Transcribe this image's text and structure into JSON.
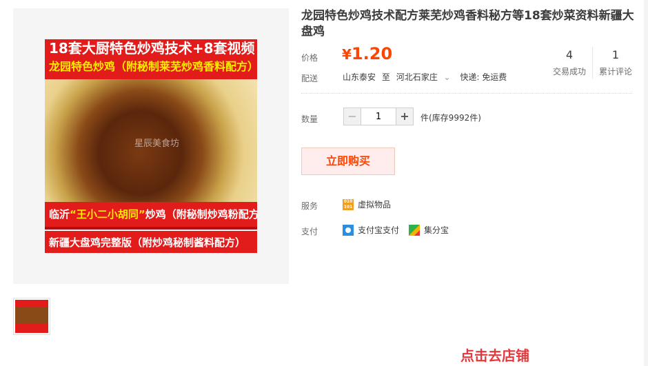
{
  "product": {
    "title": "龙园特色炒鸡技术配方莱芜炒鸡香料秘方等18套炒菜资料新疆大盘鸡",
    "price_label": "价格",
    "currency": "¥",
    "price": "1.20",
    "stats": [
      {
        "value": "4",
        "label": "交易成功"
      },
      {
        "value": "1",
        "label": "累计评论"
      }
    ]
  },
  "image": {
    "line1": "18套大厨特色炒鸡技术+8套视频",
    "line2": "龙园特色炒鸡（附秘制莱芜炒鸡香料配方）",
    "watermark": "星辰美食坊",
    "line3_prefix": "临沂",
    "line3_highlight": "“王小二小胡同”",
    "line3_suffix": "炒鸡（附秘制炒鸡粉配方）",
    "line4": "新疆大盘鸡完整版（附炒鸡秘制酱料配方）"
  },
  "shipping": {
    "label": "配送",
    "from": "山东泰安",
    "to_word": "至",
    "to": "河北石家庄",
    "express": "快递: 免运费"
  },
  "quantity": {
    "label": "数量",
    "value": "1",
    "stock": "件(库存9992件)",
    "minus": "−",
    "plus": "+"
  },
  "buy_button": "立即购买",
  "service": {
    "label": "服务",
    "item": "虚拟物品",
    "icon": "virtual-goods-icon"
  },
  "payment": {
    "label": "支付",
    "methods": [
      {
        "name": "支付宝支付",
        "icon": "alipay-icon",
        "color": "#2a8fe0"
      },
      {
        "name": "集分宝",
        "icon": "jifenbao-icon",
        "color": "#2bb24c"
      }
    ]
  },
  "promo_partial": "点击去店铺",
  "colors": {
    "price": "#ff4400",
    "poster_red": "#e21b1b",
    "poster_yellow": "#ffea00"
  }
}
